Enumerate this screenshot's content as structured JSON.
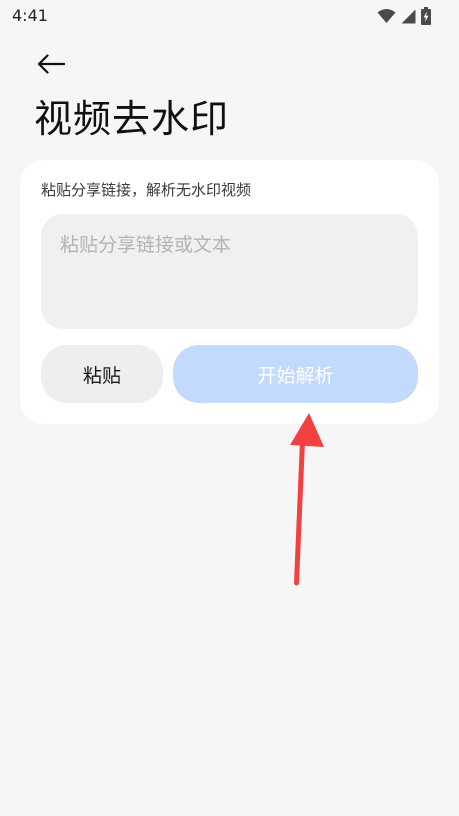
{
  "status_bar": {
    "time": "4:41",
    "icons": [
      "wifi-icon",
      "cellular-signal-icon",
      "battery-charging-icon"
    ]
  },
  "header": {
    "back_icon": "arrow-left-icon",
    "title": "视频去水印"
  },
  "card": {
    "hint": "粘贴分享链接，解析无水印视频",
    "input": {
      "value": "",
      "placeholder": "粘贴分享链接或文本"
    },
    "paste_label": "粘贴",
    "parse_label": "开始解析"
  },
  "colors": {
    "background": "#f6f6f6",
    "card": "#ffffff",
    "input_bg": "#f0f0f0",
    "paste_bg": "#eeeeee",
    "primary_disabled": "#c2dafd",
    "annotation_arrow": "#f24141"
  }
}
